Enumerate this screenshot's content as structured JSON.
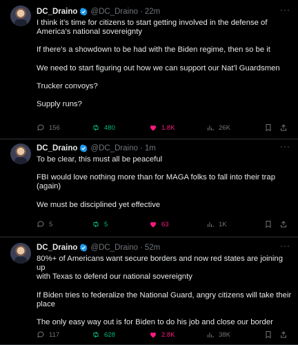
{
  "tweets": [
    {
      "name": "DC_Draino",
      "handle": "@DC_Draino",
      "dot": "·",
      "time": "22m",
      "lines": [
        "I think it’s time for citizens to start getting involved in the defense of",
        "America’s national sovereignty",
        "",
        "If there’s a showdown to be had with the Biden regime, then so be it",
        "",
        "We need to start figuring out how we can support our Nat’l Guardsmen",
        "",
        "Trucker convoys?",
        "",
        "Supply runs?"
      ],
      "replies": "156",
      "retweets": "480",
      "likes": "1.8K",
      "views": "26K"
    },
    {
      "name": "DC_Draino",
      "handle": "@DC_Draino",
      "dot": "·",
      "time": "1m",
      "lines": [
        "To be clear, this must all be peaceful",
        "",
        "FBI would love nothing more than for MAGA folks to fall into their trap",
        "(again)",
        "",
        "We must be disciplined yet effective"
      ],
      "replies": "5",
      "retweets": "5",
      "likes": "63",
      "views": "1K"
    },
    {
      "name": "DC_Draino",
      "handle": "@DC_Draino",
      "dot": "·",
      "time": "52m",
      "lines": [
        "80%+ of Americans want secure borders and now red states are joining up",
        "with Texas to defend our national sovereignty",
        "",
        "If Biden tries to federalize the National Guard, angry citizens will take their",
        "place",
        "",
        "The only easy way out is for Biden to do his job and close our border"
      ],
      "replies": "117",
      "retweets": "628",
      "likes": "2.8K",
      "views": "38K"
    }
  ],
  "icons": {
    "reply": "reply-icon",
    "retweet": "retweet-icon",
    "like": "heart-icon",
    "views": "views-icon",
    "bookmark": "bookmark-icon",
    "share": "share-icon",
    "more": "more-icon",
    "verified": "verified-badge-icon"
  },
  "colors": {
    "background": "#000000",
    "text": "#e7e9ea",
    "muted": "#71767b",
    "retweet_active": "#00ba7c",
    "like_active": "#f91880",
    "verified": "#1d9bf0"
  }
}
